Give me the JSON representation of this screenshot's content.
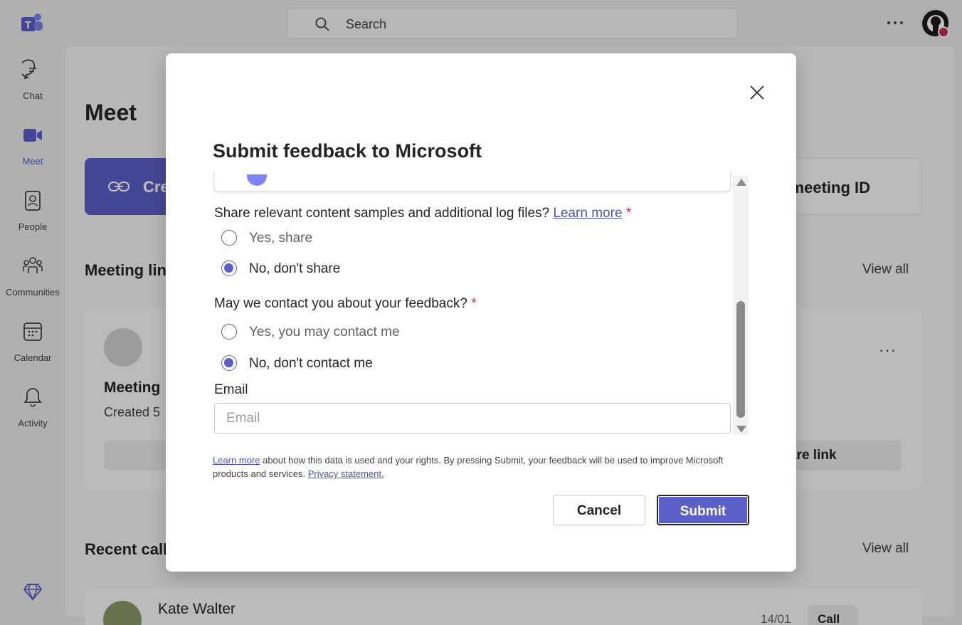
{
  "search": {
    "placeholder": "Search"
  },
  "sidebar": {
    "items": [
      {
        "label": "Chat"
      },
      {
        "label": "Meet"
      },
      {
        "label": "People"
      },
      {
        "label": "Communities"
      },
      {
        "label": "Calendar"
      },
      {
        "label": "Activity"
      }
    ]
  },
  "main": {
    "title": "Meet",
    "create_label": "Cre",
    "join_label": "meeting ID",
    "meeting_links_title": "Meeting lin",
    "view_all_1": "View all",
    "card_name": "Meeting",
    "card_created": "Created 5",
    "card_share": "are link",
    "card_more": "···",
    "recent_title": "Recent calls",
    "view_all_2": "View all",
    "recent_name": "Kate Walter",
    "recent_date": "14/01",
    "recent_call": "Call"
  },
  "modal": {
    "title": "Submit feedback to Microsoft",
    "q1_text": "Share relevant content samples and additional log files? ",
    "q1_link": "Learn more",
    "q1_required": "*",
    "q1_options": [
      {
        "label": "Yes, share",
        "selected": false
      },
      {
        "label": "No, don't share",
        "selected": true
      }
    ],
    "q2_text": "May we contact you about your feedback? ",
    "q2_required": "*",
    "q2_options": [
      {
        "label": "Yes, you may contact me",
        "selected": false
      },
      {
        "label": "No, don't contact me",
        "selected": true
      }
    ],
    "email_label": "Email",
    "email_placeholder": "Email",
    "disclaimer_link": "Learn more",
    "disclaimer_text": " about how this data is used and your rights. By pressing Submit, your feedback will be used to improve Microsoft products and services. ",
    "privacy_link": "Privacy statement.",
    "cancel_label": "Cancel",
    "submit_label": "Submit"
  },
  "colors": {
    "accent": "#5b5fc7",
    "required": "#c4314b",
    "link": "#4f52b2"
  }
}
